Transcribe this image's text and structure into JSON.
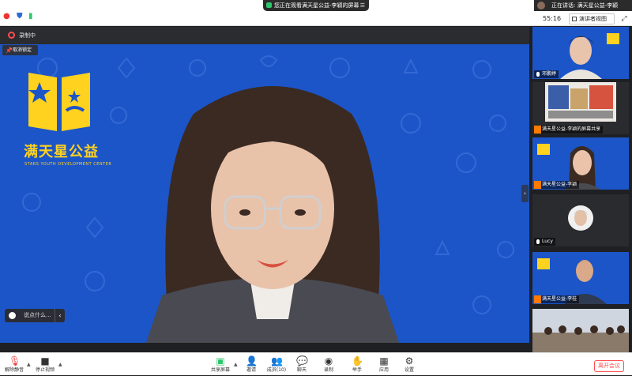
{
  "topbar": {
    "share_notice": "您正在观看满天星公益-李颖的屏幕",
    "menu_glyph": "☰",
    "speaking_notice": "正在讲话: 满天星公益-李颖",
    "timer": "55:16",
    "view_label": "演讲者视图"
  },
  "recording": {
    "label": "录制中"
  },
  "stage": {
    "unpin_label": "取消锁定",
    "logo_title": "满天星公益",
    "logo_subtitle": "STARS YOUTH DEVELOPMENT CENTER",
    "chat_placeholder": "说点什么..."
  },
  "sidebar": {
    "tiles": [
      {
        "label": "邓鹏婷",
        "badge_logo": "满天星公益",
        "kind": "person"
      },
      {
        "label": "满天星公益-李颖的屏幕共享",
        "kind": "screen"
      },
      {
        "label": "满天星公益-李颖",
        "badge_logo": "满天星公益",
        "kind": "person"
      },
      {
        "label": "Lucy",
        "kind": "avatar"
      },
      {
        "label": "满天星公益-李桂",
        "badge_logo": "满天星公益",
        "kind": "person"
      },
      {
        "label": "",
        "kind": "room"
      }
    ]
  },
  "toolbar": {
    "unmute": "解除静音",
    "stop_video": "停止视频",
    "share_screen": "共享屏幕",
    "invite": "邀请",
    "members": "成员(10)",
    "chat": "聊天",
    "record": "录制",
    "raise_hand": "举手",
    "apps": "应用",
    "settings": "设置",
    "leave": "离开会议"
  },
  "colors": {
    "stage_blue": "#1c55c8",
    "accent_yellow": "#ffd21f",
    "leave_red": "#ff4d4f"
  }
}
